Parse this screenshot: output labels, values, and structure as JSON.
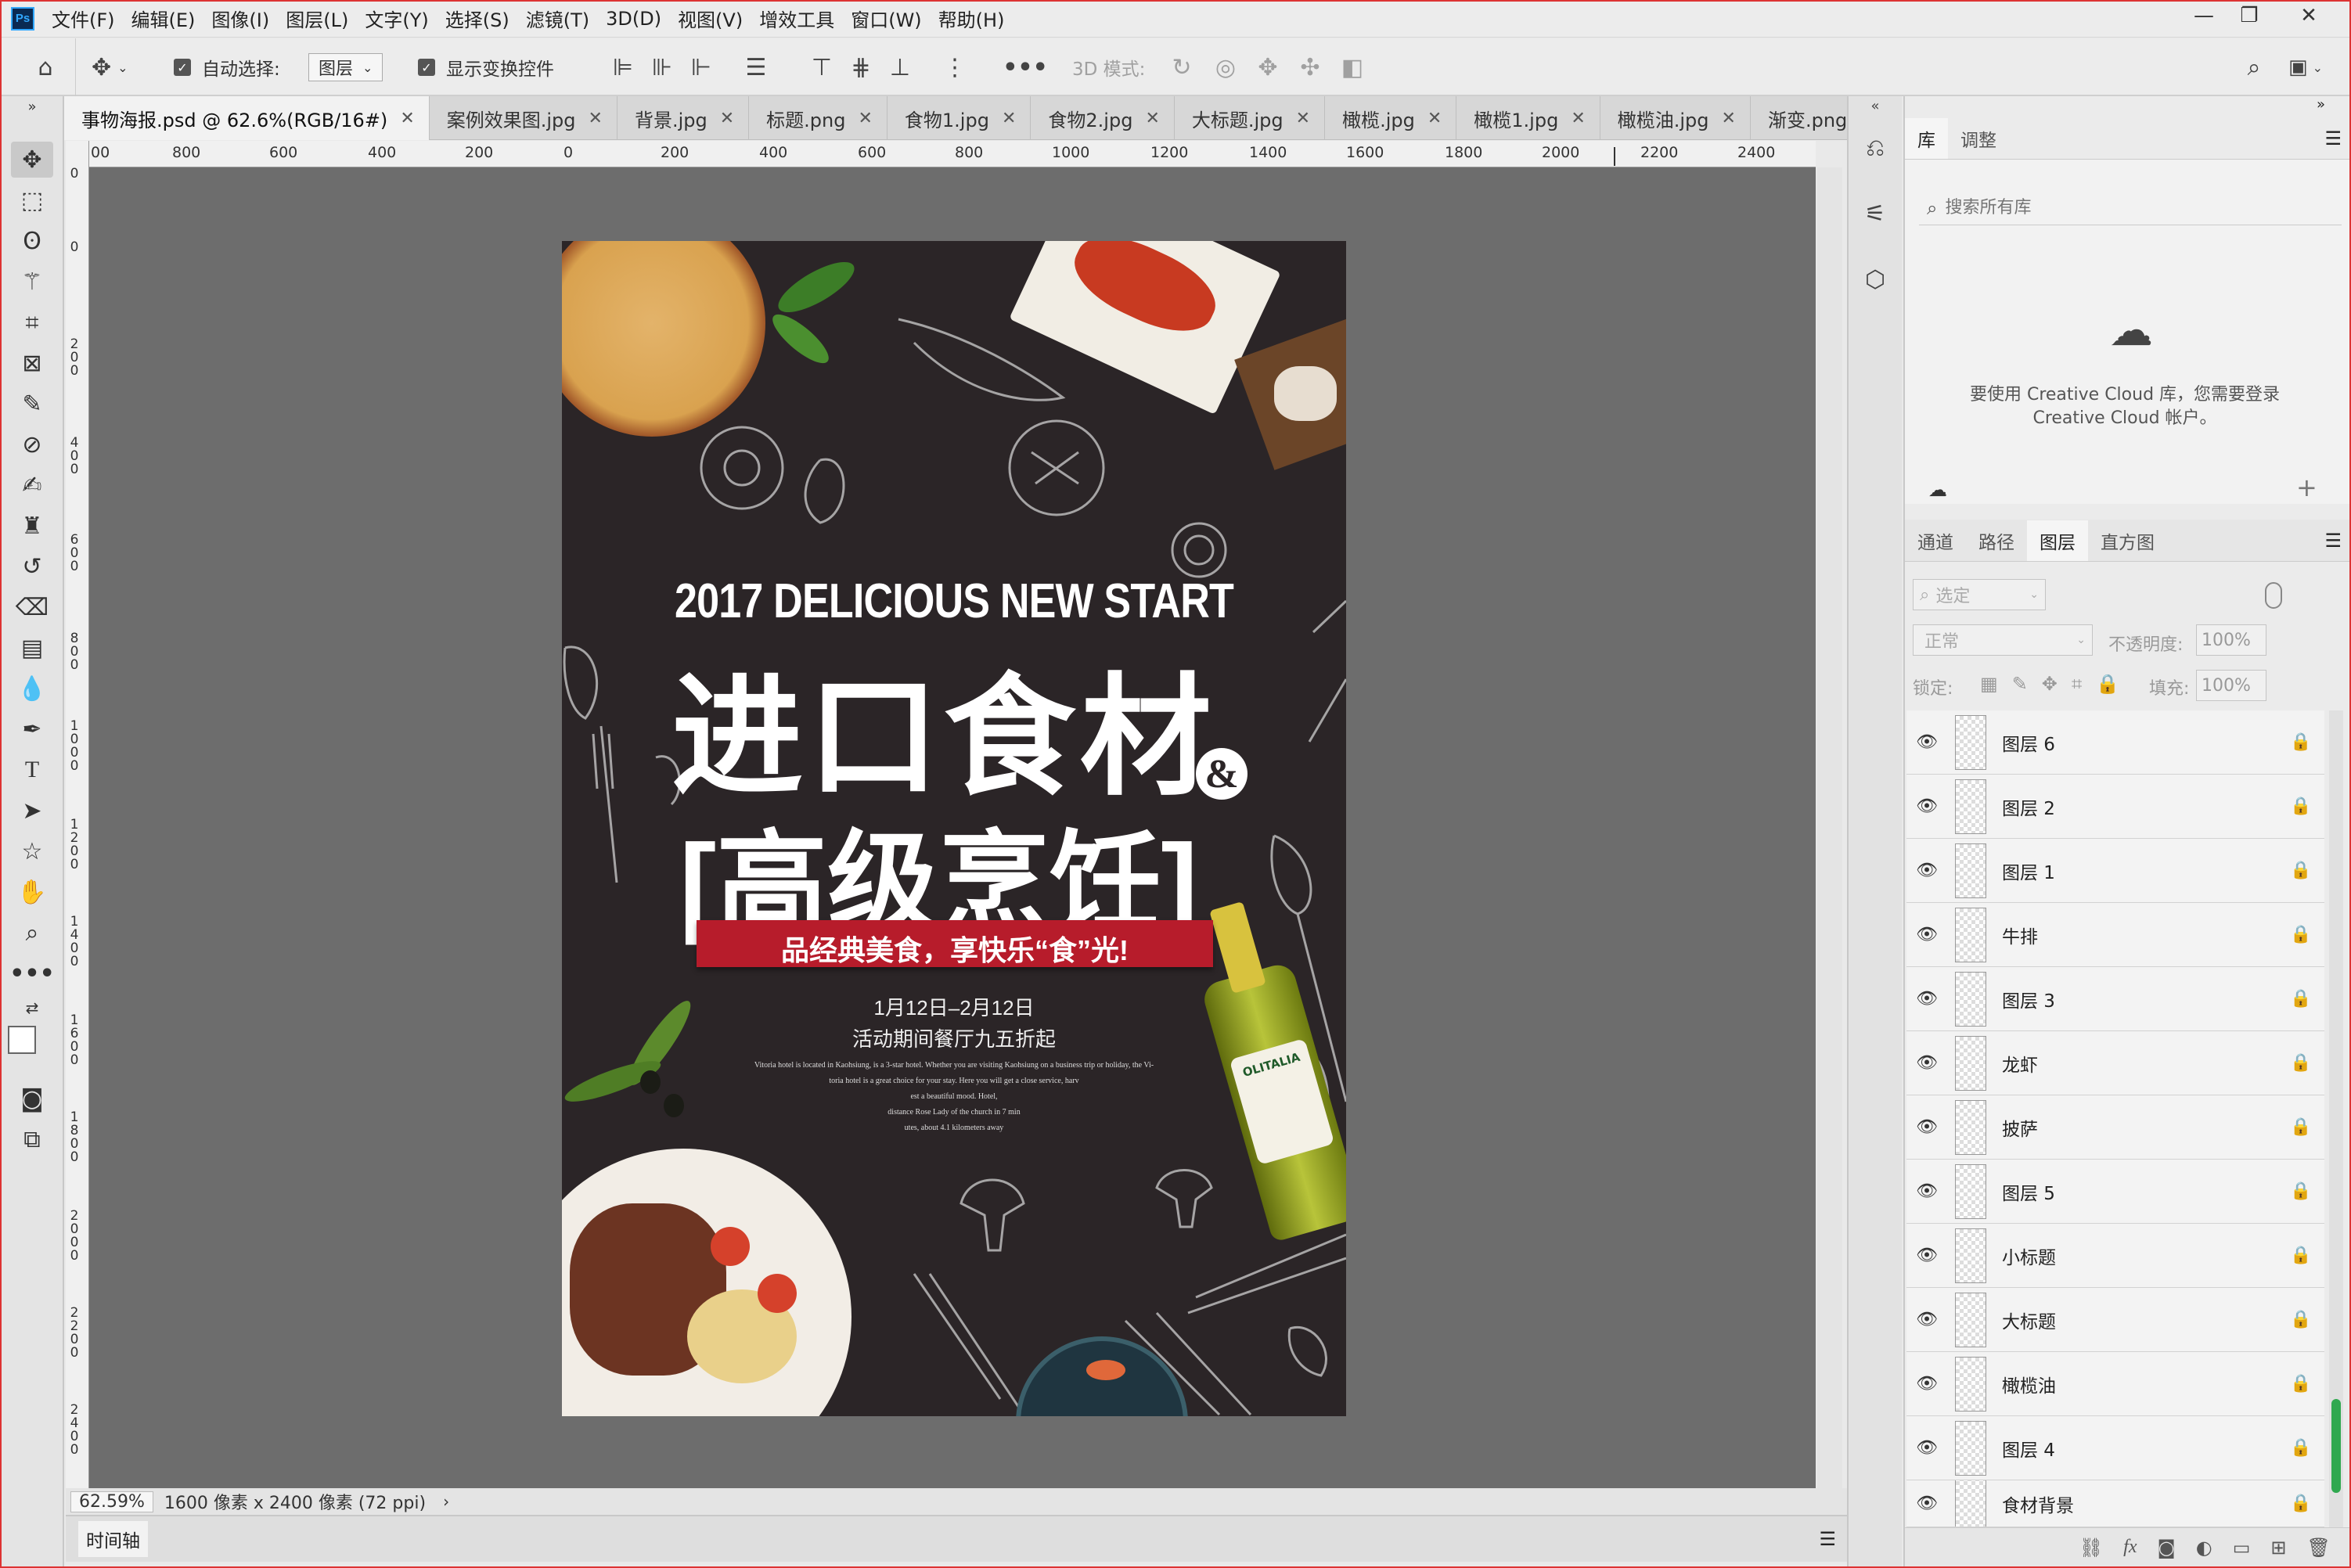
{
  "menubar": {
    "items": [
      "文件(F)",
      "编辑(E)",
      "图像(I)",
      "图层(L)",
      "文字(Y)",
      "选择(S)",
      "滤镜(T)",
      "3D(D)",
      "视图(V)",
      "增效工具",
      "窗口(W)",
      "帮助(H)"
    ]
  },
  "options": {
    "auto_select_label": "自动选择:",
    "auto_select_value": "图层",
    "show_transform_label": "显示变换控件",
    "three_d_mode_label": "3D 模式:"
  },
  "tabs": [
    {
      "label": "事物海报.psd @ 62.6%(RGB/16#)",
      "active": true
    },
    {
      "label": "案例效果图.jpg",
      "active": false
    },
    {
      "label": "背景.jpg",
      "active": false
    },
    {
      "label": "标题.png",
      "active": false
    },
    {
      "label": "食物1.jpg",
      "active": false
    },
    {
      "label": "食物2.jpg",
      "active": false
    },
    {
      "label": "大标题.jpg",
      "active": false
    },
    {
      "label": "橄榄.jpg",
      "active": false
    },
    {
      "label": "橄榄1.jpg",
      "active": false
    },
    {
      "label": "橄榄油.jpg",
      "active": false
    },
    {
      "label": "渐变.png",
      "active": false
    }
  ],
  "ruler_h": [
    "00",
    "800",
    "600",
    "400",
    "200",
    "0",
    "200",
    "400",
    "600",
    "800",
    "1000",
    "1200",
    "1400",
    "1600",
    "1800",
    "2000",
    "2200",
    "2400"
  ],
  "ruler_v": [
    "0",
    "0",
    "2 0 0",
    "4 0 0",
    "6 0 0",
    "8 0 0",
    "1 0 0 0",
    "1 2 0 0",
    "1 4 0 0",
    "1 6 0 0",
    "1 8 0 0",
    "2 0 0 0",
    "2 2 0 0",
    "2 4 0 0"
  ],
  "poster": {
    "headline_en": "2017 DELICIOUS NEW START",
    "title_line1": "进口食材",
    "ampersand": "&",
    "title_line2": "[高级烹饪]",
    "banner": "品经典美食，享快乐“食”光!",
    "date_range": "1月12日–2月12日",
    "promo": "活动期间餐厅九五折起",
    "body_lines": [
      "Vitoria hotel is located in Kaohsiung, is a 3-star hotel. Whether you are visiting Kaohsiung on a business trip or holiday, the Vi-",
      "toria hotel is a great choice for your stay. Here you will get a close service, harv",
      "est a beautiful mood. Hotel,",
      "distance Rose Lady of the church in 7 min",
      "utes, about 4.1 kilometers away"
    ],
    "bottle_brand": "OLITALIA"
  },
  "status": {
    "zoom": "62.59%",
    "doc_size": "1600 像素 x 2400 像素 (72 ppi)"
  },
  "timeline_label": "时间轴",
  "library": {
    "tabs": [
      "库",
      "调整"
    ],
    "search_placeholder": "搜索所有库",
    "message": "要使用 Creative Cloud 库，您需要登录 Creative Cloud 帐户。"
  },
  "layers_panel": {
    "tabs": [
      "通道",
      "路径",
      "图层",
      "直方图"
    ],
    "filter_placeholder": "选定",
    "blend_mode": "正常",
    "opacity_label": "不透明度:",
    "opacity_value": "100%",
    "lock_label": "锁定:",
    "fill_label": "填充:",
    "fill_value": "100%",
    "layers": [
      "图层 6",
      "图层 2",
      "图层 1",
      "牛排",
      "图层 3",
      "龙虾",
      "披萨",
      "图层 5",
      "小标题",
      "大标题",
      "橄榄油",
      "图层 4",
      "食材背景"
    ]
  },
  "colors": {
    "poster_bg": "#2b2527",
    "banner_red": "#b71c2b",
    "ps_blue": "#31a8ff"
  }
}
